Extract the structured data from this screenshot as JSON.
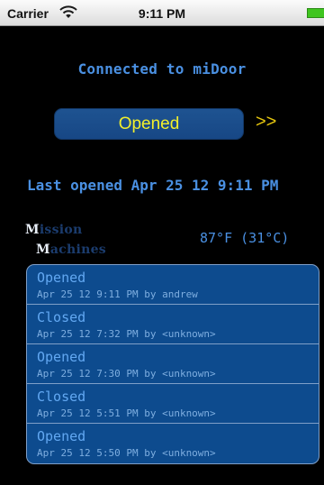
{
  "status_bar": {
    "carrier": "Carrier",
    "time": "9:11 PM",
    "wifi_icon": "wifi-icon",
    "battery_icon": "battery-icon",
    "battery_color": "#3fc51f"
  },
  "header": {
    "connected_text": "Connected to miDoor"
  },
  "door": {
    "button_label": "Opened",
    "arrows": ">>",
    "button_color": "#1e5391",
    "label_color": "#f2ef2c"
  },
  "last_opened": "Last opened Apr 25 12 9:11 PM",
  "logo": {
    "line1_cap": "M",
    "line1_rest": "ission",
    "line2_cap": "M",
    "line2_rest": "achines"
  },
  "temperature": "87°F (31°C)",
  "log": [
    {
      "state": "Opened",
      "detail": "Apr 25 12 9:11 PM by andrew"
    },
    {
      "state": "Closed",
      "detail": "Apr 25 12 7:32 PM by <unknown>"
    },
    {
      "state": "Opened",
      "detail": "Apr 25 12 7:30 PM by <unknown>"
    },
    {
      "state": "Closed",
      "detail": "Apr 25 12 5:51 PM by <unknown>"
    },
    {
      "state": "Opened",
      "detail": "Apr 25 12 5:50 PM by <unknown>"
    }
  ]
}
